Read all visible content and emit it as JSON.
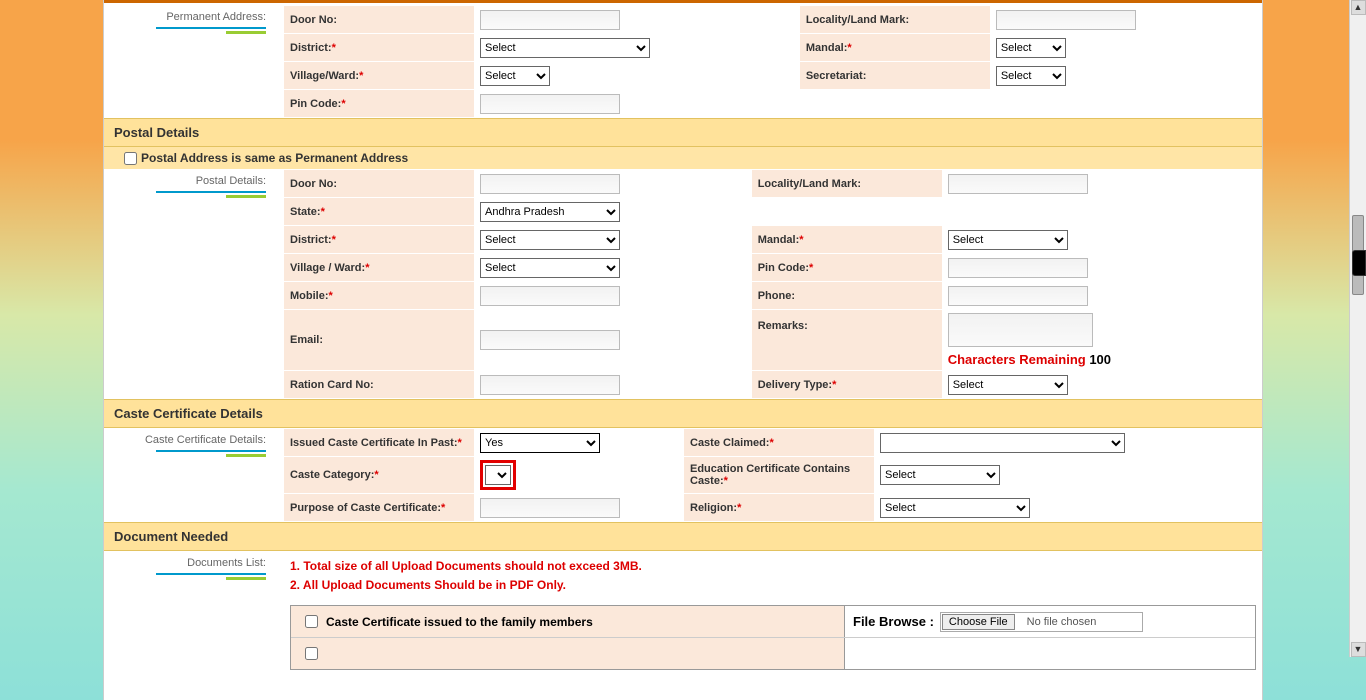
{
  "perm": {
    "title": "Permanent Address:",
    "door_lbl": "Door No:",
    "locality_lbl": "Locality/Land Mark:",
    "district_lbl": "District:",
    "district_sel": "Select",
    "mandal_lbl": "Mandal:",
    "mandal_sel": "Select",
    "village_lbl": "Village/Ward:",
    "village_sel": "Select",
    "secretariat_lbl": "Secretariat:",
    "secretariat_sel": "Select",
    "pincode_lbl": "Pin Code:"
  },
  "postal": {
    "header": "Postal Details",
    "same_lbl": "Postal Address is same as Permanent Address",
    "title": "Postal Details:",
    "door_lbl": "Door No:",
    "locality_lbl": "Locality/Land Mark:",
    "state_lbl": "State:",
    "state_sel": "Andhra Pradesh",
    "district_lbl": "District:",
    "district_sel": "Select",
    "mandal_lbl": "Mandal:",
    "mandal_sel": "Select",
    "village_lbl": "Village / Ward:",
    "village_sel": "Select",
    "pincode_lbl": "Pin Code:",
    "mobile_lbl": "Mobile:",
    "phone_lbl": "Phone:",
    "email_lbl": "Email:",
    "remarks_lbl": "Remarks:",
    "remaining_red": "Characters Remaining ",
    "remaining_num": "100",
    "ration_lbl": "Ration Card No:",
    "delivery_lbl": "Delivery Type:",
    "delivery_sel": "Select"
  },
  "caste": {
    "header": "Caste Certificate Details",
    "title": "Caste Certificate Details:",
    "issued_lbl": "Issued Caste Certificate In Past:",
    "issued_sel": "Yes",
    "claimed_lbl": "Caste Claimed:",
    "category_lbl": "Caste Category:",
    "edu_lbl": "Education Certificate Contains Caste:",
    "edu_sel": "Select",
    "purpose_lbl": "Purpose of Caste Certificate:",
    "religion_lbl": "Religion:",
    "religion_sel": "Select"
  },
  "docs": {
    "header": "Document Needed",
    "title": "Documents List:",
    "note1": "1. Total size of all Upload Documents should not exceed 3MB.",
    "note2": "2. All Upload Documents Should be in PDF Only.",
    "row1": "Caste Certificate issued to the family members",
    "browse": "File Browse :",
    "choose": "Choose File",
    "nofile": "No file chosen"
  }
}
